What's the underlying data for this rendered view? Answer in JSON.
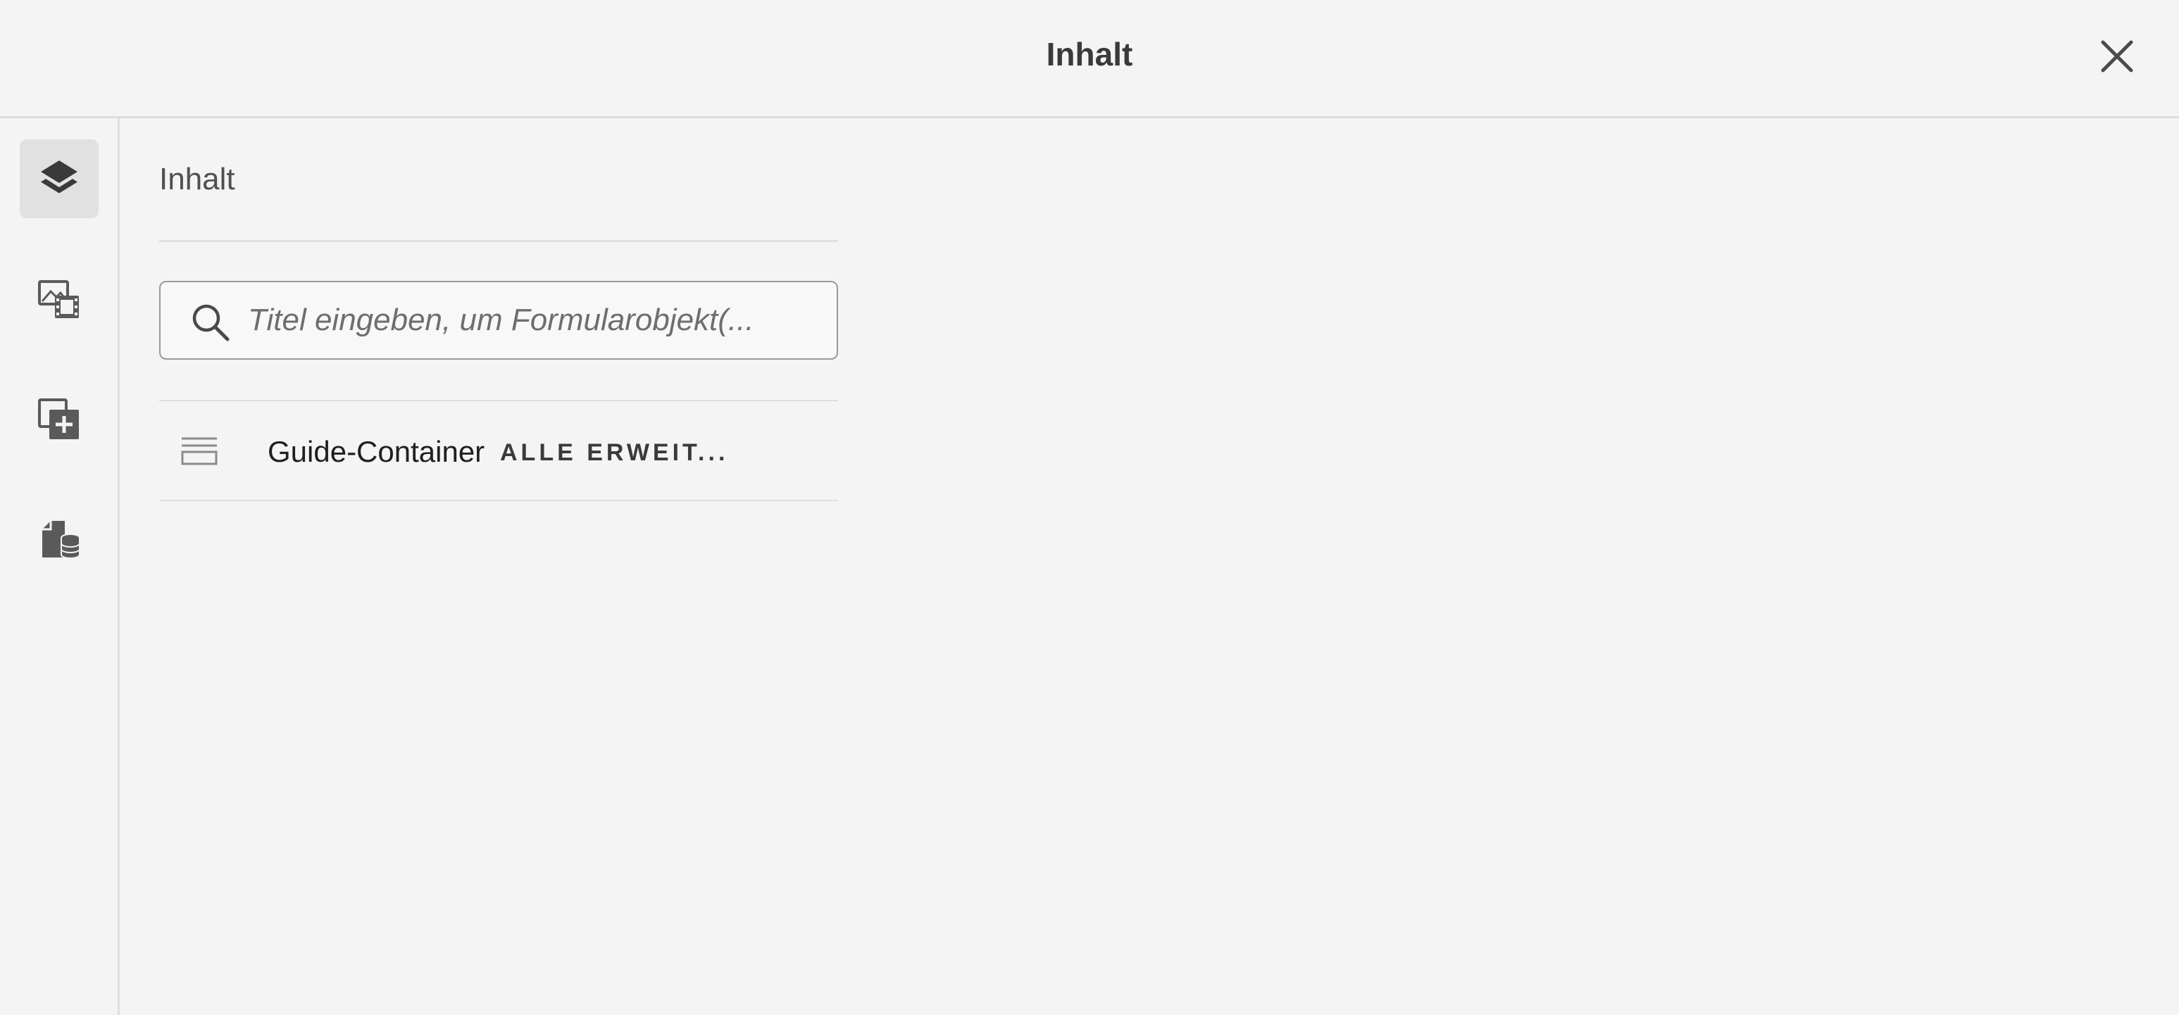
{
  "header": {
    "title": "Inhalt",
    "close_icon": "close-icon"
  },
  "sidebar": {
    "items": [
      {
        "icon": "layers-icon",
        "active": true
      },
      {
        "icon": "assets-icon",
        "active": false
      },
      {
        "icon": "add-component-icon",
        "active": false
      },
      {
        "icon": "data-sources-icon",
        "active": false
      }
    ]
  },
  "panel": {
    "title": "Inhalt",
    "search": {
      "placeholder": "Titel eingeben, um Formularobjekt(...",
      "value": ""
    },
    "tree": [
      {
        "label": "Guide-Container",
        "tag": "ALLE ERWEIT..."
      }
    ]
  },
  "colors": {
    "background": "#f4f4f4",
    "active_rail": "#e1e1e1",
    "text": "#2c2c2c",
    "icon": "#5a5a5a"
  }
}
